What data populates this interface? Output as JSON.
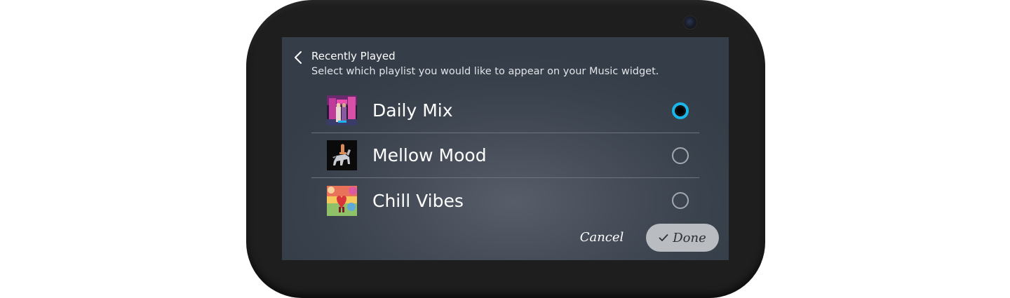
{
  "header": {
    "title": "Recently Played",
    "subtitle": "Select which playlist you would like to appear on your Music widget.",
    "back_icon": "chevron-left-icon"
  },
  "playlists": [
    {
      "label": "Daily Mix",
      "selected": true
    },
    {
      "label": "Mellow Mood",
      "selected": false
    },
    {
      "label": "Chill Vibes",
      "selected": false
    }
  ],
  "actions": {
    "cancel_label": "Cancel",
    "done_label": "Done",
    "done_icon": "check-icon"
  },
  "colors": {
    "accent": "#1ab6e9",
    "device_frame": "#1e1e1e",
    "screen_bg": "#3a424d",
    "done_button_bg": "#b9bcc1"
  }
}
